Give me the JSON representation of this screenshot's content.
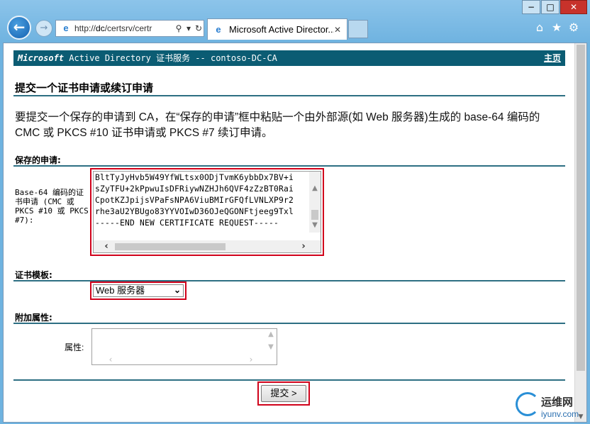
{
  "browser": {
    "address_url_prefix": "http://",
    "address_url_host": "dc",
    "address_url_path": "/certsrv/certr",
    "tab_title": "Microsoft Active Director...",
    "search_glyph": "⚲",
    "dropdown_glyph": "▾",
    "refresh_glyph": "↻",
    "tab_close_glyph": "✕",
    "back_glyph": "←",
    "forward_glyph": "→",
    "window_buttons": {
      "minimize": "−",
      "maximize": "□",
      "close": "✕"
    },
    "toolbar_icons": [
      "home-icon",
      "star-icon",
      "gear-icon"
    ]
  },
  "banner": {
    "brand": "Microsoft",
    "text": " Active Directory 证书服务  --  contoso-DC-CA",
    "home_link": "主页"
  },
  "page": {
    "title": "提交一个证书申请或续订申请",
    "intro": "要提交一个保存的申请到 CA，在“保存的申请”框中粘贴一个由外部源(如 Web 服务器)生成的 base-64 编码的 CMC 或 PKCS #10 证书申请或 PKCS #7 续订申请。",
    "saved_request_heading": "保存的申请:",
    "saved_request_label": "Base-64 编码的证书申请 (CMC 或 PKCS #10 或 PKCS #7):",
    "request_lines": [
      "BltTyJyHvb5W49YfWLtsx0ODjTvmK6ybbDx7BV+i",
      "sZyTFU+2kPpwuIsDFRiywNZHJh6QVF4zZzBT0Rai",
      "CpotKZJpijsVPaFsNPA6ViuBMIrGFQfLVNLXP9r2",
      "rhe3aU2YBUgo83YYVOIwD36OJeQGONFtjeeg9Txl",
      "-----END NEW CERTIFICATE REQUEST-----"
    ],
    "template_heading": "证书模板:",
    "template_selected": "Web 服务器",
    "extra_attrs_heading": "附加属性:",
    "attrs_label": "属性:",
    "attrs_value": "",
    "submit_label": "提交 >"
  },
  "watermark": {
    "cn": "运维网",
    "en": "iyunv.com"
  },
  "colors": {
    "banner_bg": "#0b5c73",
    "rule": "#2d6f83",
    "highlight": "#d0021b"
  }
}
